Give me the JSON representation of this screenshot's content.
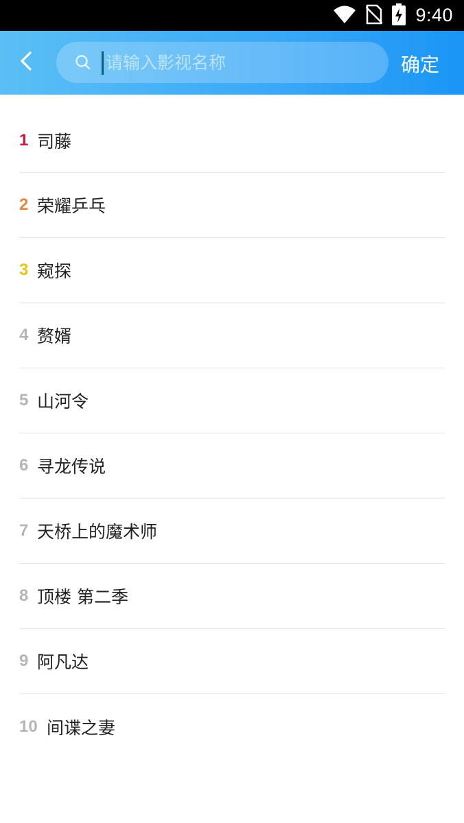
{
  "status_bar": {
    "time": "9:40"
  },
  "search": {
    "placeholder": "请输入影视名称",
    "value": ""
  },
  "header": {
    "confirm_label": "确定"
  },
  "rank_colors": {
    "top1": "#c31b3b",
    "top2": "#e8883a",
    "top3": "#e6c21a",
    "rest": "#b5b5b5"
  },
  "list": [
    {
      "rank": "1",
      "title": "司藤"
    },
    {
      "rank": "2",
      "title": "荣耀乒乓"
    },
    {
      "rank": "3",
      "title": "窥探"
    },
    {
      "rank": "4",
      "title": "赘婿"
    },
    {
      "rank": "5",
      "title": "山河令"
    },
    {
      "rank": "6",
      "title": "寻龙传说"
    },
    {
      "rank": "7",
      "title": "天桥上的魔术师"
    },
    {
      "rank": "8",
      "title": "顶楼 第二季"
    },
    {
      "rank": "9",
      "title": "阿凡达"
    },
    {
      "rank": "10",
      "title": "间谍之妻"
    }
  ]
}
